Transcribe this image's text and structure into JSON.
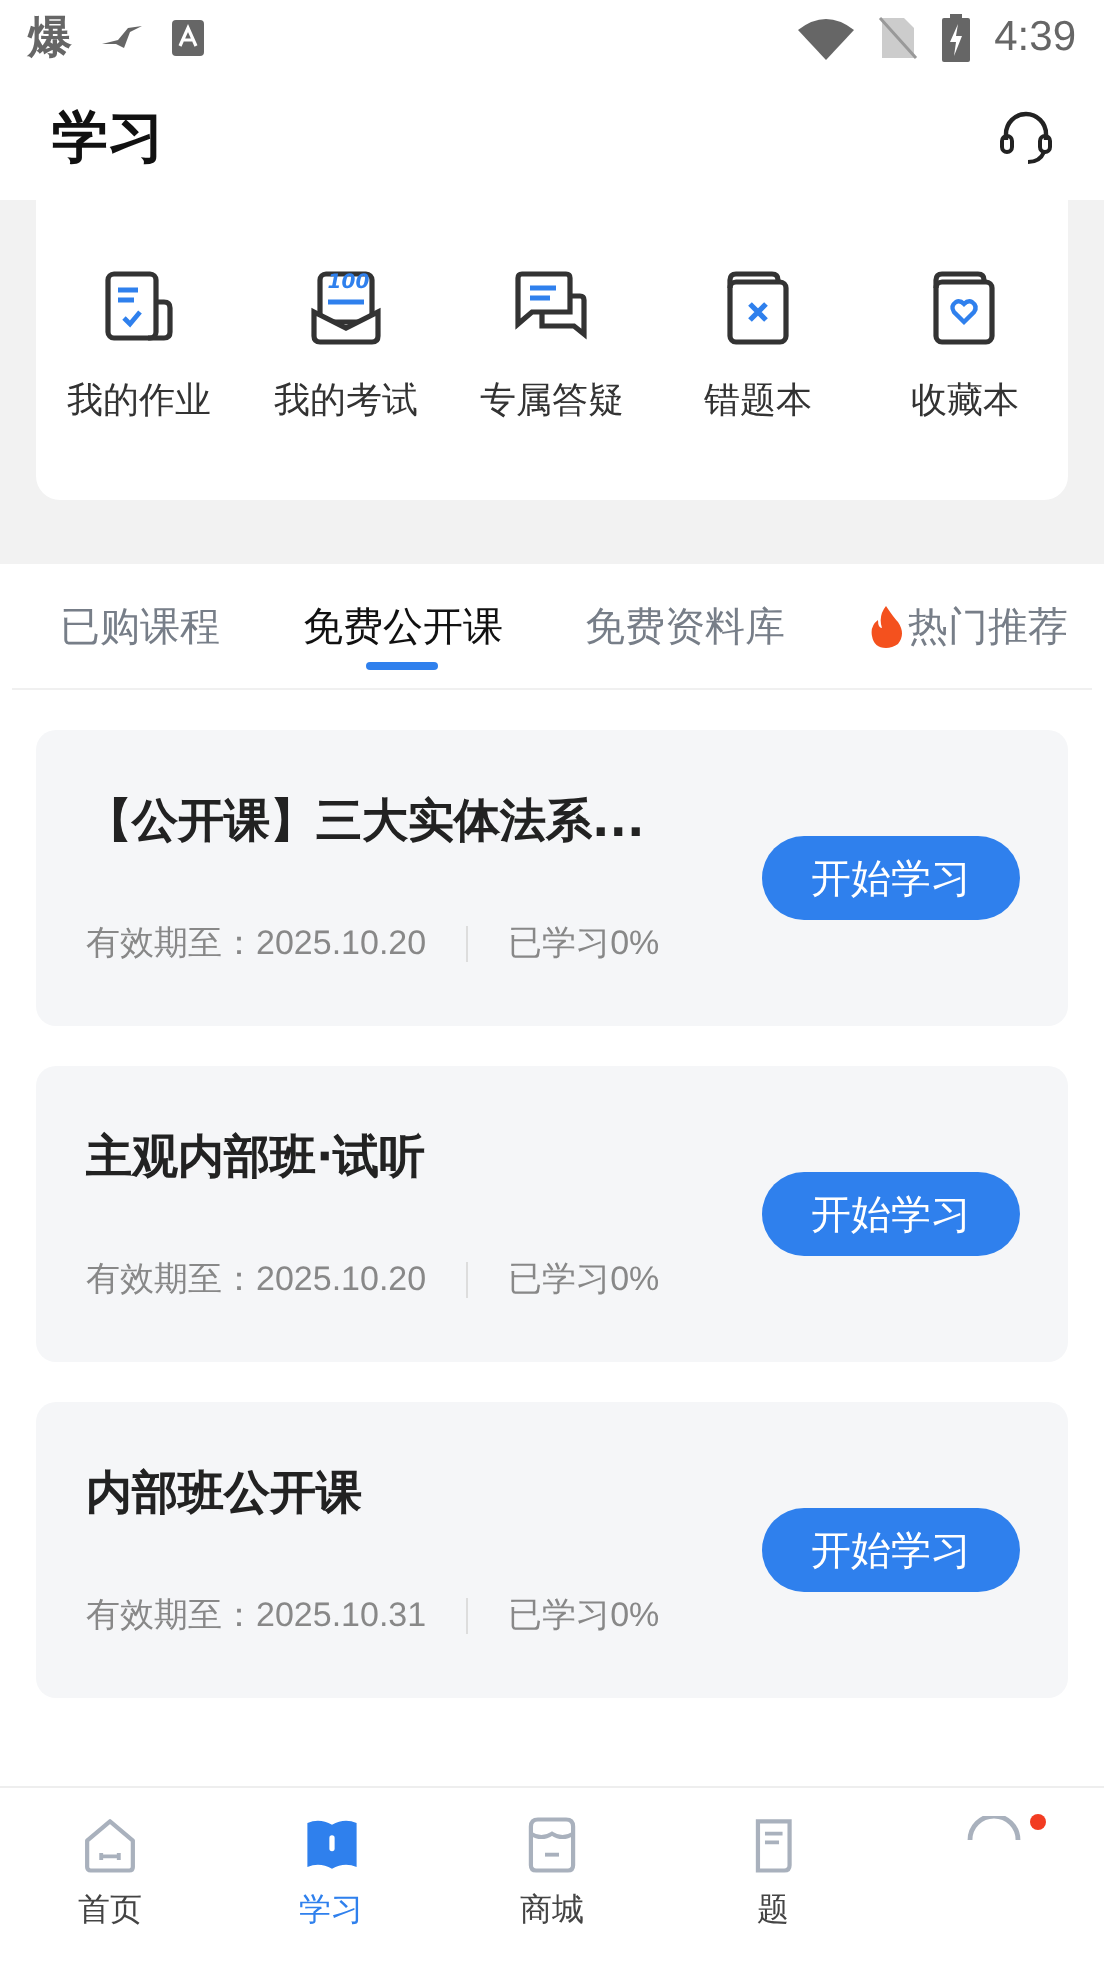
{
  "status_bar": {
    "app_glyph": "爆",
    "time": "4:39"
  },
  "header": {
    "title": "学习"
  },
  "shortcuts": [
    {
      "label": "我的作业",
      "kind": "homework"
    },
    {
      "label": "我的考试",
      "kind": "exam",
      "badge": "100"
    },
    {
      "label": "专属答疑",
      "kind": "qa"
    },
    {
      "label": "错题本",
      "kind": "mistakes"
    },
    {
      "label": "收藏本",
      "kind": "favorites"
    }
  ],
  "tabs": [
    {
      "label": "已购课程",
      "selected": false
    },
    {
      "label": "免费公开课",
      "selected": true
    },
    {
      "label": "免费资料库",
      "selected": false
    },
    {
      "label": "热门推荐",
      "selected": false,
      "hot": true
    }
  ],
  "courses": [
    {
      "title": "【公开课】三大实体法系...",
      "validity": "有效期至：2025.10.20",
      "progress": "已学习0%",
      "button": "开始学习"
    },
    {
      "title": "主观内部班·试听",
      "validity": "有效期至：2025.10.20",
      "progress": "已学习0%",
      "button": "开始学习"
    },
    {
      "title": "内部班公开课",
      "validity": "有效期至：2025.10.31",
      "progress": "已学习0%",
      "button": "开始学习"
    }
  ],
  "bottom_nav": [
    {
      "label": "首页",
      "kind": "home",
      "selected": false
    },
    {
      "label": "学习",
      "kind": "study",
      "selected": true
    },
    {
      "label": "商城",
      "kind": "shop",
      "selected": false
    },
    {
      "label": "题",
      "kind": "questions",
      "selected": false
    },
    {
      "kind": "profile",
      "selected": false,
      "dot": true
    }
  ]
}
